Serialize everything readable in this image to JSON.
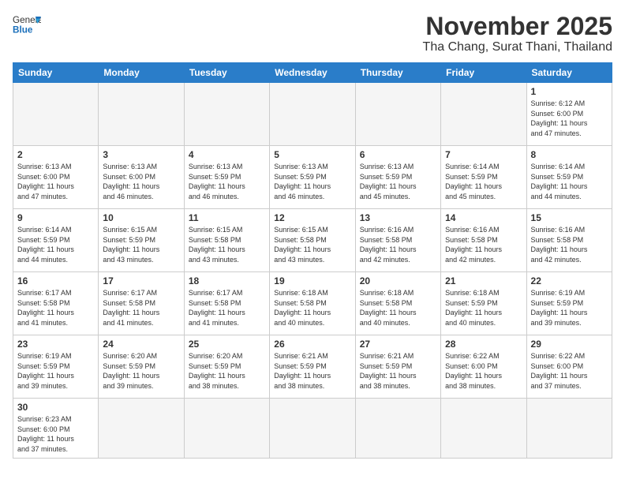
{
  "header": {
    "logo_general": "General",
    "logo_blue": "Blue",
    "title": "November 2025",
    "subtitle": "Tha Chang, Surat Thani, Thailand"
  },
  "weekdays": [
    "Sunday",
    "Monday",
    "Tuesday",
    "Wednesday",
    "Thursday",
    "Friday",
    "Saturday"
  ],
  "days": [
    {
      "num": "",
      "info": "",
      "empty": true
    },
    {
      "num": "",
      "info": "",
      "empty": true
    },
    {
      "num": "",
      "info": "",
      "empty": true
    },
    {
      "num": "",
      "info": "",
      "empty": true
    },
    {
      "num": "",
      "info": "",
      "empty": true
    },
    {
      "num": "",
      "info": "",
      "empty": true
    },
    {
      "num": "1",
      "info": "Sunrise: 6:12 AM\nSunset: 6:00 PM\nDaylight: 11 hours\nand 47 minutes.",
      "empty": false
    },
    {
      "num": "2",
      "info": "Sunrise: 6:13 AM\nSunset: 6:00 PM\nDaylight: 11 hours\nand 47 minutes.",
      "empty": false
    },
    {
      "num": "3",
      "info": "Sunrise: 6:13 AM\nSunset: 6:00 PM\nDaylight: 11 hours\nand 46 minutes.",
      "empty": false
    },
    {
      "num": "4",
      "info": "Sunrise: 6:13 AM\nSunset: 5:59 PM\nDaylight: 11 hours\nand 46 minutes.",
      "empty": false
    },
    {
      "num": "5",
      "info": "Sunrise: 6:13 AM\nSunset: 5:59 PM\nDaylight: 11 hours\nand 46 minutes.",
      "empty": false
    },
    {
      "num": "6",
      "info": "Sunrise: 6:13 AM\nSunset: 5:59 PM\nDaylight: 11 hours\nand 45 minutes.",
      "empty": false
    },
    {
      "num": "7",
      "info": "Sunrise: 6:14 AM\nSunset: 5:59 PM\nDaylight: 11 hours\nand 45 minutes.",
      "empty": false
    },
    {
      "num": "8",
      "info": "Sunrise: 6:14 AM\nSunset: 5:59 PM\nDaylight: 11 hours\nand 44 minutes.",
      "empty": false
    },
    {
      "num": "9",
      "info": "Sunrise: 6:14 AM\nSunset: 5:59 PM\nDaylight: 11 hours\nand 44 minutes.",
      "empty": false
    },
    {
      "num": "10",
      "info": "Sunrise: 6:15 AM\nSunset: 5:59 PM\nDaylight: 11 hours\nand 43 minutes.",
      "empty": false
    },
    {
      "num": "11",
      "info": "Sunrise: 6:15 AM\nSunset: 5:58 PM\nDaylight: 11 hours\nand 43 minutes.",
      "empty": false
    },
    {
      "num": "12",
      "info": "Sunrise: 6:15 AM\nSunset: 5:58 PM\nDaylight: 11 hours\nand 43 minutes.",
      "empty": false
    },
    {
      "num": "13",
      "info": "Sunrise: 6:16 AM\nSunset: 5:58 PM\nDaylight: 11 hours\nand 42 minutes.",
      "empty": false
    },
    {
      "num": "14",
      "info": "Sunrise: 6:16 AM\nSunset: 5:58 PM\nDaylight: 11 hours\nand 42 minutes.",
      "empty": false
    },
    {
      "num": "15",
      "info": "Sunrise: 6:16 AM\nSunset: 5:58 PM\nDaylight: 11 hours\nand 42 minutes.",
      "empty": false
    },
    {
      "num": "16",
      "info": "Sunrise: 6:17 AM\nSunset: 5:58 PM\nDaylight: 11 hours\nand 41 minutes.",
      "empty": false
    },
    {
      "num": "17",
      "info": "Sunrise: 6:17 AM\nSunset: 5:58 PM\nDaylight: 11 hours\nand 41 minutes.",
      "empty": false
    },
    {
      "num": "18",
      "info": "Sunrise: 6:17 AM\nSunset: 5:58 PM\nDaylight: 11 hours\nand 41 minutes.",
      "empty": false
    },
    {
      "num": "19",
      "info": "Sunrise: 6:18 AM\nSunset: 5:58 PM\nDaylight: 11 hours\nand 40 minutes.",
      "empty": false
    },
    {
      "num": "20",
      "info": "Sunrise: 6:18 AM\nSunset: 5:58 PM\nDaylight: 11 hours\nand 40 minutes.",
      "empty": false
    },
    {
      "num": "21",
      "info": "Sunrise: 6:18 AM\nSunset: 5:59 PM\nDaylight: 11 hours\nand 40 minutes.",
      "empty": false
    },
    {
      "num": "22",
      "info": "Sunrise: 6:19 AM\nSunset: 5:59 PM\nDaylight: 11 hours\nand 39 minutes.",
      "empty": false
    },
    {
      "num": "23",
      "info": "Sunrise: 6:19 AM\nSunset: 5:59 PM\nDaylight: 11 hours\nand 39 minutes.",
      "empty": false
    },
    {
      "num": "24",
      "info": "Sunrise: 6:20 AM\nSunset: 5:59 PM\nDaylight: 11 hours\nand 39 minutes.",
      "empty": false
    },
    {
      "num": "25",
      "info": "Sunrise: 6:20 AM\nSunset: 5:59 PM\nDaylight: 11 hours\nand 38 minutes.",
      "empty": false
    },
    {
      "num": "26",
      "info": "Sunrise: 6:21 AM\nSunset: 5:59 PM\nDaylight: 11 hours\nand 38 minutes.",
      "empty": false
    },
    {
      "num": "27",
      "info": "Sunrise: 6:21 AM\nSunset: 5:59 PM\nDaylight: 11 hours\nand 38 minutes.",
      "empty": false
    },
    {
      "num": "28",
      "info": "Sunrise: 6:22 AM\nSunset: 6:00 PM\nDaylight: 11 hours\nand 38 minutes.",
      "empty": false
    },
    {
      "num": "29",
      "info": "Sunrise: 6:22 AM\nSunset: 6:00 PM\nDaylight: 11 hours\nand 37 minutes.",
      "empty": false
    },
    {
      "num": "30",
      "info": "Sunrise: 6:23 AM\nSunset: 6:00 PM\nDaylight: 11 hours\nand 37 minutes.",
      "empty": false
    },
    {
      "num": "",
      "info": "",
      "empty": true
    },
    {
      "num": "",
      "info": "",
      "empty": true
    },
    {
      "num": "",
      "info": "",
      "empty": true
    },
    {
      "num": "",
      "info": "",
      "empty": true
    },
    {
      "num": "",
      "info": "",
      "empty": true
    },
    {
      "num": "",
      "info": "",
      "empty": true
    }
  ]
}
